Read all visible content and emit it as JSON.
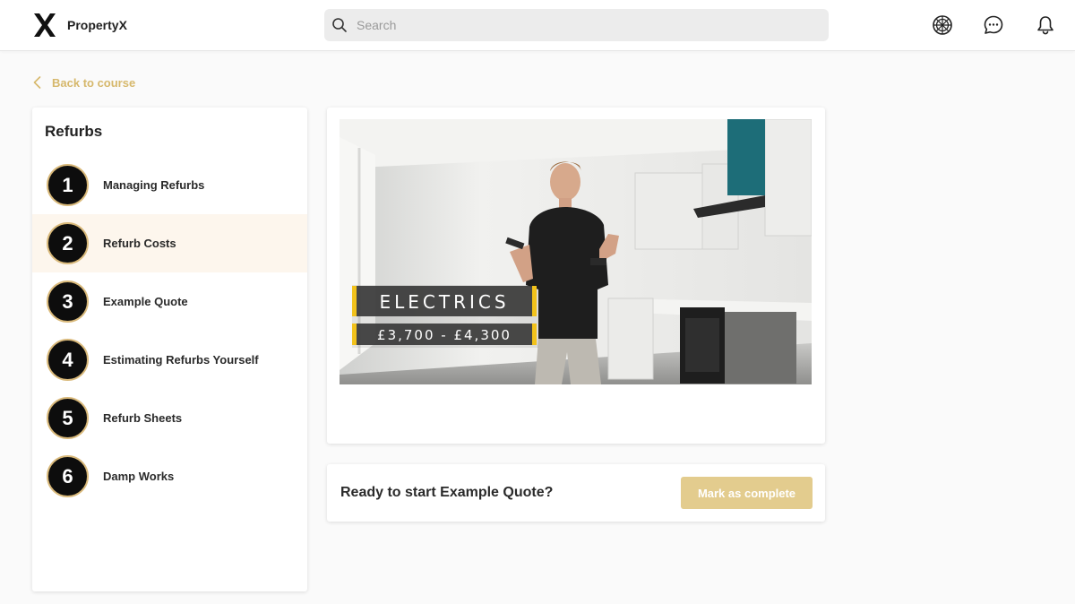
{
  "app": {
    "brand": "PropertyX"
  },
  "search": {
    "placeholder": "Search"
  },
  "nav": {
    "back_label": "Back to course"
  },
  "sidebar": {
    "title": "Refurbs",
    "lessons": [
      {
        "number": "1",
        "label": "Managing Refurbs",
        "active": false
      },
      {
        "number": "2",
        "label": "Refurb Costs",
        "active": true
      },
      {
        "number": "3",
        "label": "Example Quote",
        "active": false
      },
      {
        "number": "4",
        "label": "Estimating Refurbs Yourself",
        "active": false
      },
      {
        "number": "5",
        "label": "Refurb Sheets",
        "active": false
      },
      {
        "number": "6",
        "label": "Damp Works",
        "active": false
      }
    ]
  },
  "video": {
    "caption_title": "ELECTRICS",
    "caption_range": "£3,700 - £4,300"
  },
  "next": {
    "prompt": "Ready to start Example Quote?",
    "complete_label": "Mark as complete"
  },
  "colors": {
    "accent_gold": "#d6b86c",
    "button_gold": "#e3cc8e",
    "active_row": "#fdf6ed",
    "caption_yellow": "#f2c21b"
  },
  "icons": [
    "x-logo-icon",
    "search-icon",
    "globe-icon",
    "chat-icon",
    "bell-icon",
    "chevron-left-icon"
  ]
}
